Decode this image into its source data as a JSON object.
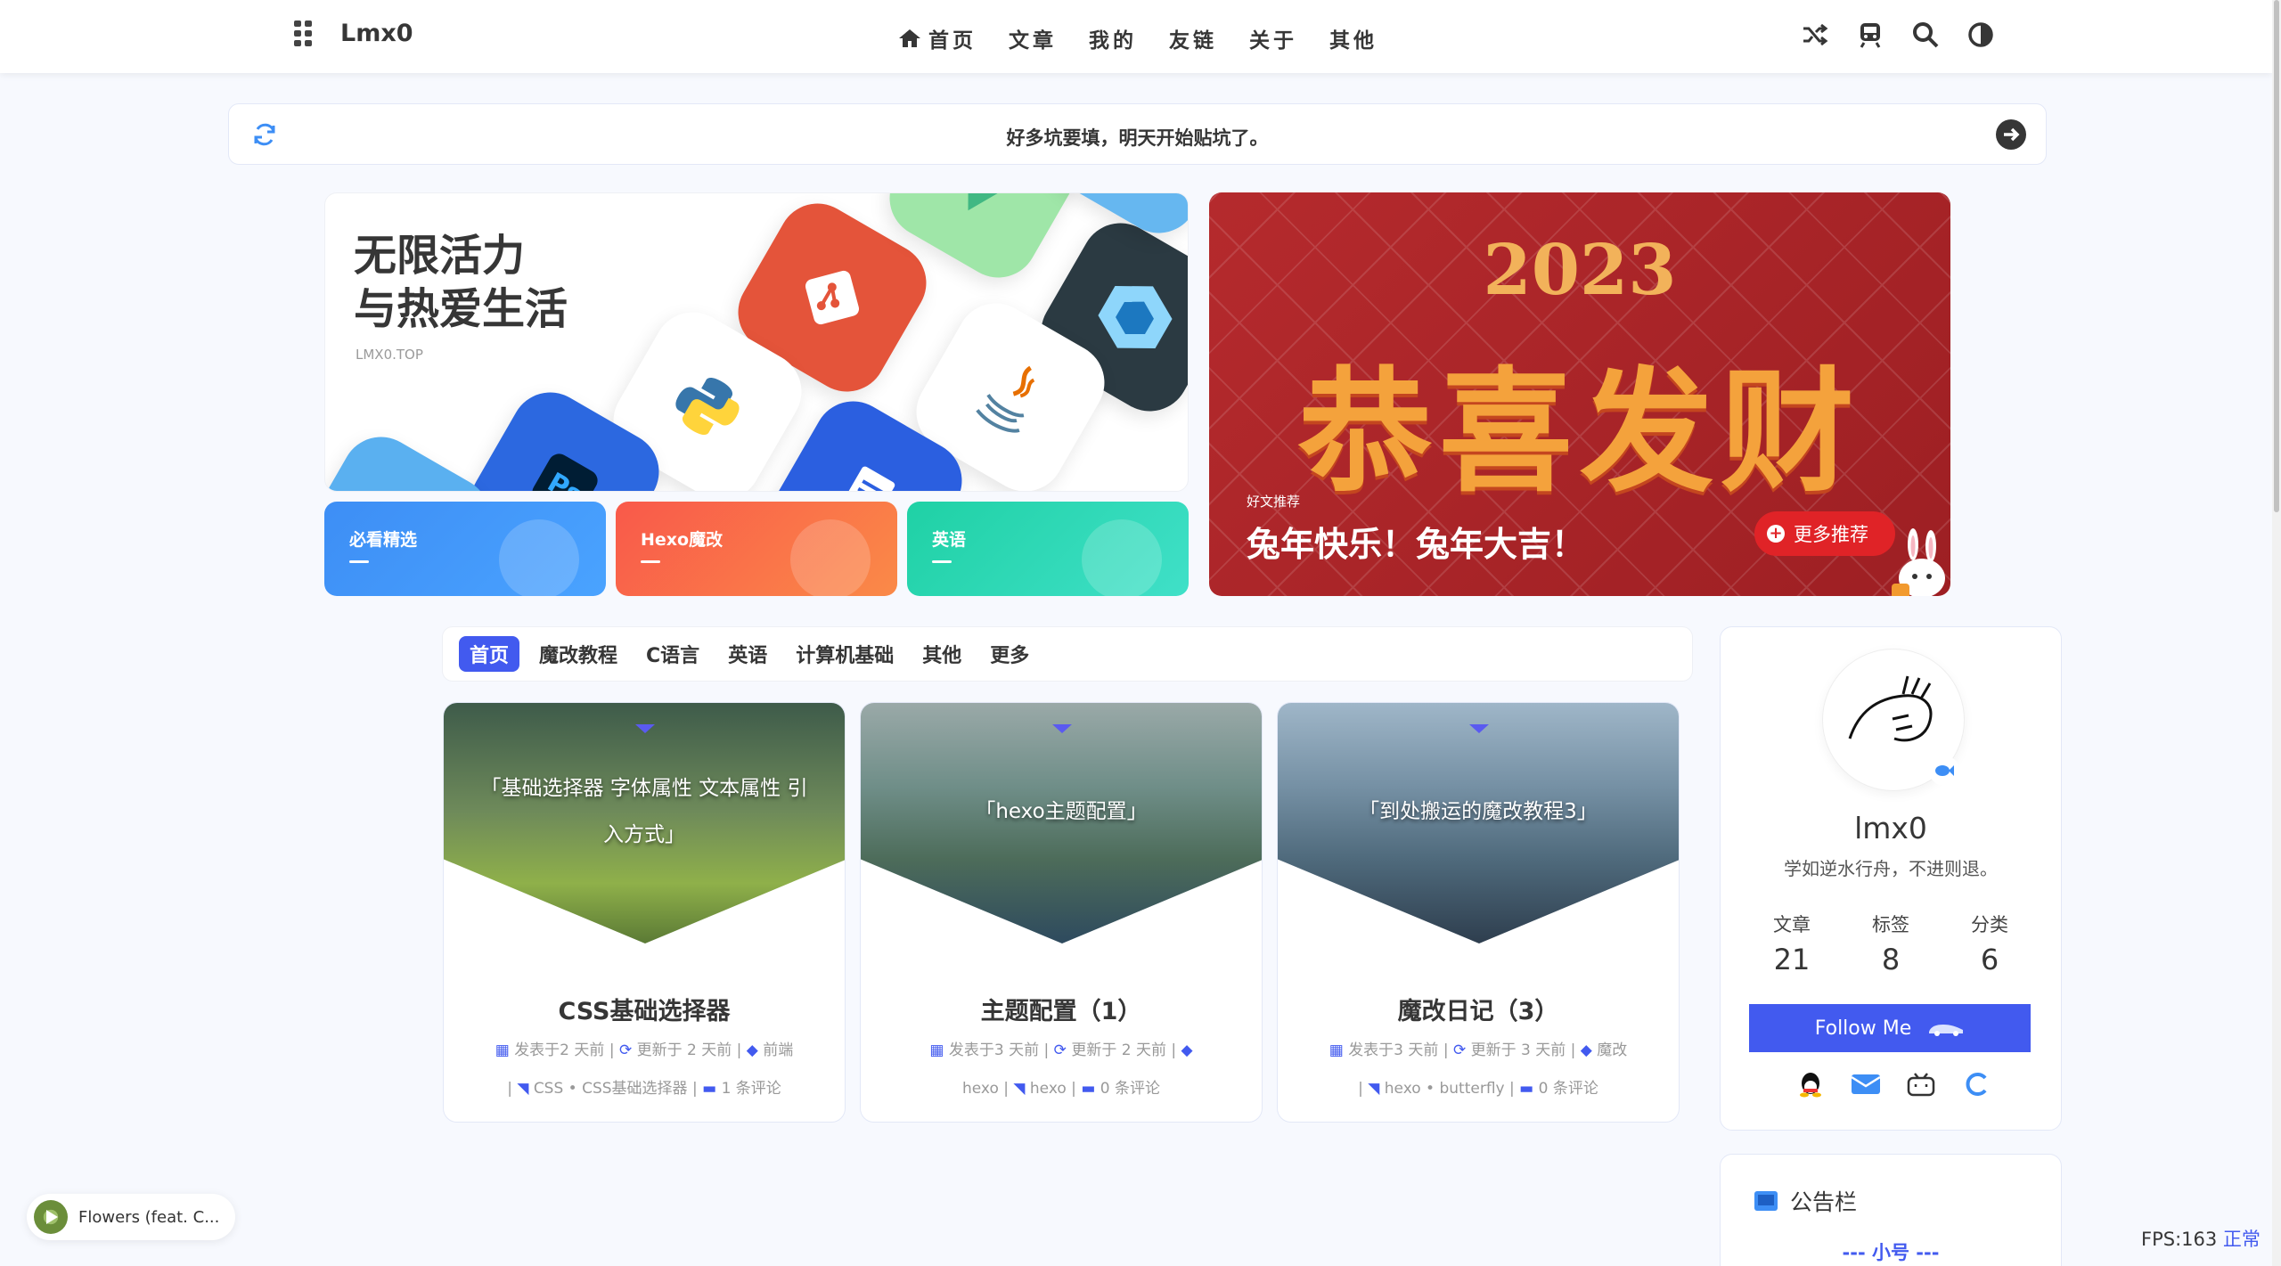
{
  "nav": {
    "brand": "Lmx0",
    "menu": [
      "首页",
      "文章",
      "我的",
      "友链",
      "关于",
      "其他"
    ],
    "right_icons": [
      "random-icon",
      "train-icon",
      "search-icon",
      "darkmode-icon"
    ]
  },
  "bulletin": {
    "text": "好多坑要填，明天开始贴坑了。"
  },
  "hero_left": {
    "title_line1": "无限活力",
    "title_line2": "与热爱生活",
    "subtitle": "LMX0.TOP",
    "categories": [
      {
        "label": "必看精选",
        "color": "#3d8ef5"
      },
      {
        "label": "Hexo魔改",
        "color": "#f96a4b"
      },
      {
        "label": "英语",
        "color": "#2ed6b0"
      }
    ]
  },
  "hero_right": {
    "year": "2023",
    "blessing": "恭喜发财",
    "small_label": "好文推荐",
    "title": "兔年快乐！兔年大吉！",
    "more_button": "更多推荐"
  },
  "tabs": [
    "首页",
    "魔改教程",
    "C语言",
    "英语",
    "计算机基础",
    "其他",
    "更多"
  ],
  "posts": [
    {
      "cover_text": "「基础选择器 字体属性 文本属性 引入方式」",
      "title": "CSS基础选择器",
      "meta_line1": [
        "发表于2 天前",
        "更新于 2 天前",
        "前端"
      ],
      "meta_line2": [
        "CSS",
        "CSS基础选择器",
        "1 条评论"
      ]
    },
    {
      "cover_text": "「hexo主题配置」",
      "title": "主题配置（1）",
      "meta_line1": [
        "发表于3 天前",
        "更新于 2 天前",
        ""
      ],
      "meta_line2": [
        "hexo",
        "hexo",
        "0 条评论"
      ]
    },
    {
      "cover_text": "「到处搬运的魔改教程3」",
      "title": "魔改日记（3）",
      "meta_line1": [
        "发表于3 天前",
        "更新于 3 天前",
        "魔改"
      ],
      "meta_line2": [
        "hexo",
        "butterfly",
        "0 条评论"
      ]
    }
  ],
  "profile": {
    "name": "lmx0",
    "description": "学如逆水行舟，不进则退。",
    "stats": [
      {
        "label": "文章",
        "value": "21"
      },
      {
        "label": "标签",
        "value": "8"
      },
      {
        "label": "分类",
        "value": "6"
      }
    ],
    "follow_label": "Follow Me",
    "socials": [
      "qq-icon",
      "mail-icon",
      "bilibili-icon",
      "csdn-icon"
    ]
  },
  "announcement": {
    "title": "公告栏",
    "subtitle": "--- 小号 ---"
  },
  "music": {
    "song": "Flowers (feat. C..."
  },
  "fps": {
    "label": "FPS:163",
    "status": "正常"
  },
  "colors": {
    "accent": "#425aef",
    "background": "#f7f9fe",
    "red_banner": "#b52a2d"
  }
}
